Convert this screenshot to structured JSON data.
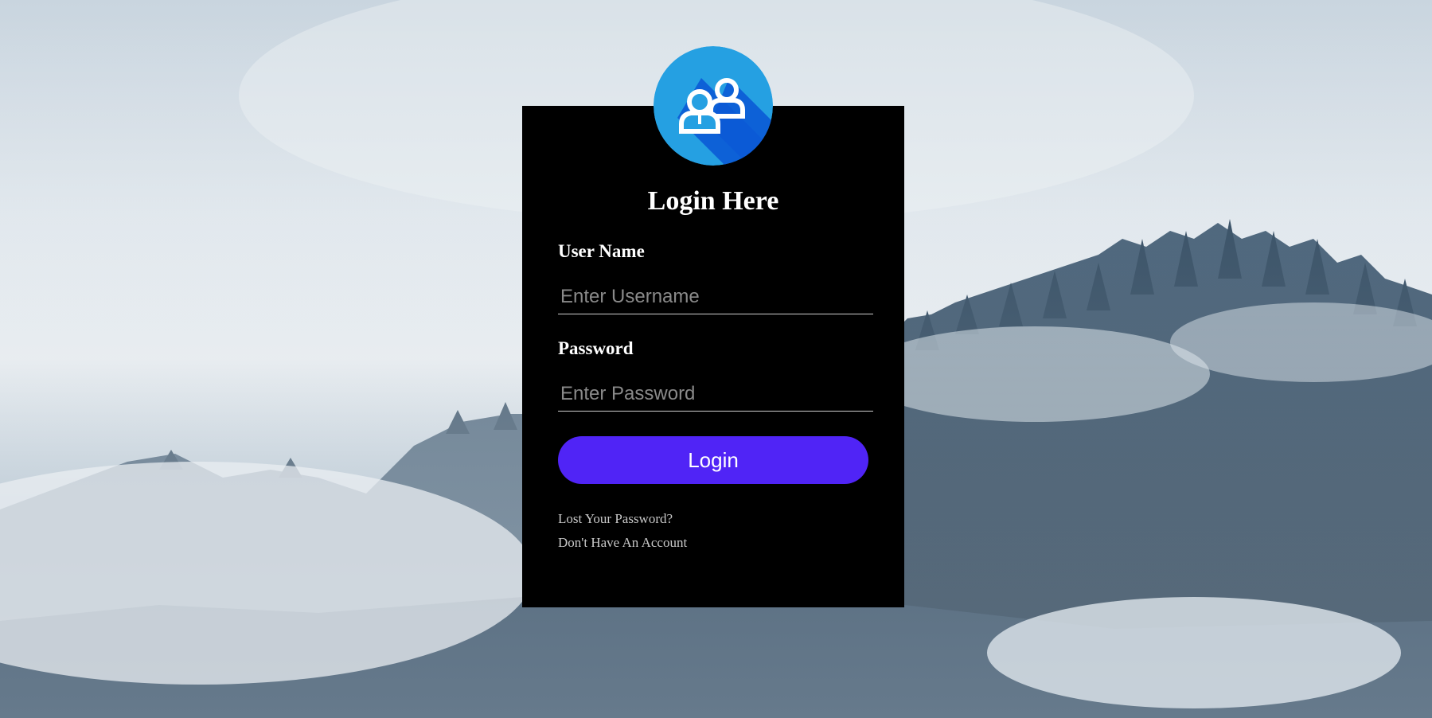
{
  "login_form": {
    "title": "Login Here",
    "username": {
      "label": "User Name",
      "placeholder": "Enter Username",
      "value": ""
    },
    "password": {
      "label": "Password",
      "placeholder": "Enter Password",
      "value": ""
    },
    "submit_label": "Login",
    "links": {
      "lost_password": "Lost Your Password?",
      "no_account": "Don't Have An Account"
    }
  },
  "avatar": {
    "icon": "users-icon"
  },
  "colors": {
    "form_background": "#000000",
    "button": "#5024f6",
    "avatar_light": "#25a0e2",
    "avatar_dark": "#0b5ad6",
    "link_text": "#c8c8c8"
  }
}
